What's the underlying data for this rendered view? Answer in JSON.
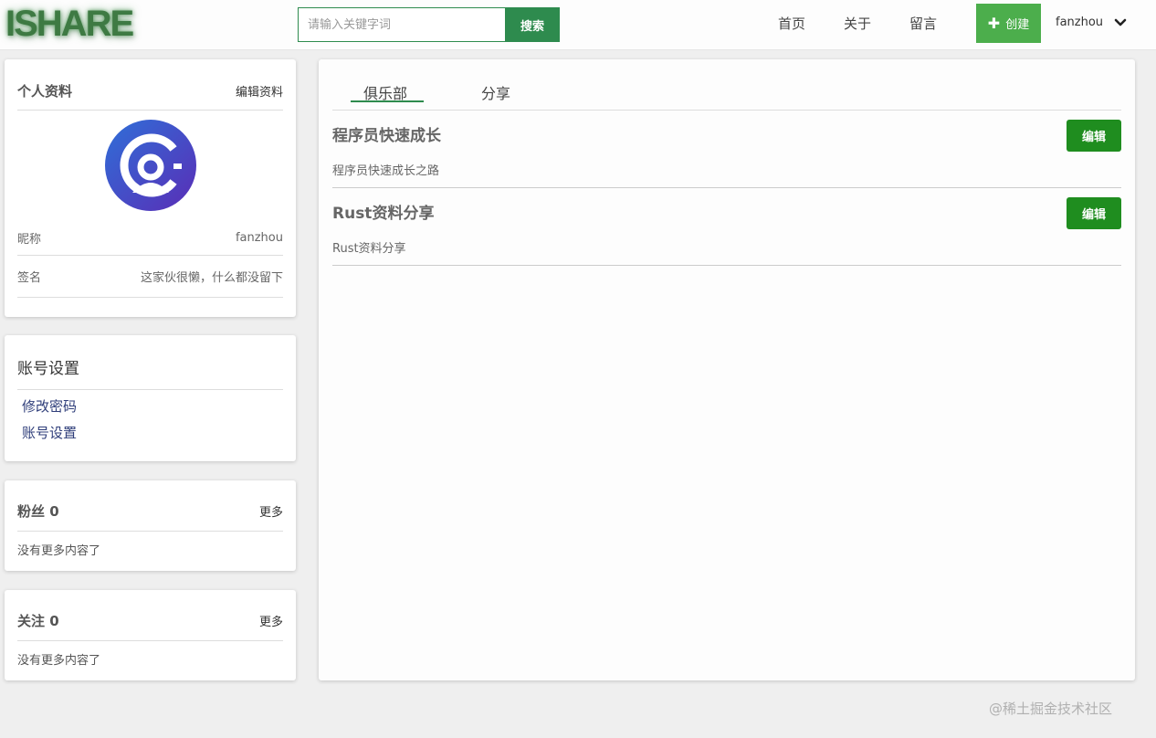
{
  "header": {
    "logo": "ISHARE",
    "search_placeholder": "请输入关键字词",
    "search_button": "搜索",
    "nav": [
      "首页",
      "关于",
      "留言"
    ],
    "create_button": "创建",
    "username": "fanzhou"
  },
  "profile": {
    "title": "个人资料",
    "edit_link": "编辑资料",
    "avatar_icon": "app-logo-avatar",
    "nickname_label": "昵称",
    "nickname_value": "fanzhou",
    "signature_label": "签名",
    "signature_value": "这家伙很懒，什么都没留下"
  },
  "account": {
    "title": "账号设置",
    "links": [
      "修改密码",
      "账号设置"
    ]
  },
  "fans": {
    "title": "粉丝 0",
    "more": "更多",
    "empty": "没有更多内容了"
  },
  "follow": {
    "title": "关注 0",
    "more": "更多",
    "empty": "没有更多内容了"
  },
  "main": {
    "tabs": [
      "俱乐部",
      "分享"
    ],
    "active_tab": "俱乐部",
    "items": [
      {
        "title": "程序员快速成长",
        "desc": "程序员快速成长之路",
        "edit": "编辑"
      },
      {
        "title": "Rust资料分享",
        "desc": "Rust资料分享",
        "edit": "编辑"
      }
    ]
  },
  "watermark": "@稀土掘金技术社区",
  "colors": {
    "brand_green": "#2e8b4e",
    "create_green": "#4cae4c",
    "edit_green": "#1f8d1f",
    "avatar_purple": "#4f2fb8",
    "background": "#efefef"
  }
}
